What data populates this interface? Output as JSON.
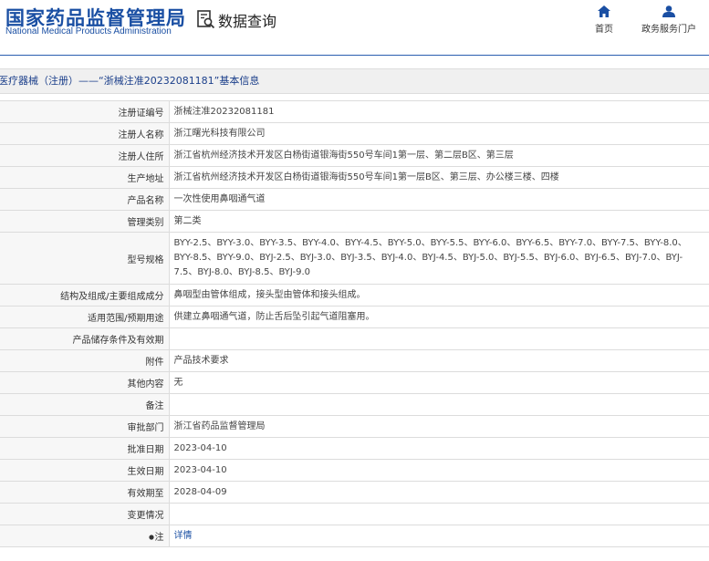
{
  "header": {
    "logo_cn": "国家药品监督管理局",
    "logo_en": "National Medical Products Administration",
    "query_title": "数据查询",
    "nav": [
      {
        "label": "首页",
        "icon": "home-icon"
      },
      {
        "label": "政务服务门户",
        "icon": "user-icon"
      }
    ],
    "accent_color": "#1a4fa3"
  },
  "breadcrumb": "医疗器械（注册）——“浙械注准20232081181”基本信息",
  "rows": [
    {
      "label": "注册证编号",
      "value": "浙械注准20232081181"
    },
    {
      "label": "注册人名称",
      "value": "浙江曙光科技有限公司"
    },
    {
      "label": "注册人住所",
      "value": "浙江省杭州经济技术开发区白杨街道银海街550号车间1第一层、第二层B区、第三层"
    },
    {
      "label": "生产地址",
      "value": "浙江省杭州经济技术开发区白杨街道银海街550号车间1第一层B区、第三层、办公楼三楼、四楼"
    },
    {
      "label": "产品名称",
      "value": "一次性使用鼻咽通气道"
    },
    {
      "label": "管理类别",
      "value": "第二类"
    },
    {
      "label": "型号规格",
      "value": "BYY-2.5、BYY-3.0、BYY-3.5、BYY-4.0、BYY-4.5、BYY-5.0、BYY-5.5、BYY-6.0、BYY-6.5、BYY-7.0、BYY-7.5、BYY-8.0、BYY-8.5、BYY-9.0、BYJ-2.5、BYJ-3.0、BYJ-3.5、BYJ-4.0、BYJ-4.5、BYJ-5.0、BYJ-5.5、BYJ-6.0、BYJ-6.5、BYJ-7.0、BYJ-7.5、BYJ-8.0、BYJ-8.5、BYJ-9.0"
    },
    {
      "label": "结构及组成/主要组成成分",
      "value": "鼻咽型由管体组成，接头型由管体和接头组成。"
    },
    {
      "label": "适用范围/预期用途",
      "value": "供建立鼻咽通气道，防止舌后坠引起气道阻塞用。"
    },
    {
      "label": "产品储存条件及有效期",
      "value": ""
    },
    {
      "label": "附件",
      "value": "产品技术要求"
    },
    {
      "label": "其他内容",
      "value": "无"
    },
    {
      "label": "备注",
      "value": ""
    },
    {
      "label": "审批部门",
      "value": "浙江省药品监督管理局"
    },
    {
      "label": "批准日期",
      "value": "2023-04-10"
    },
    {
      "label": "生效日期",
      "value": "2023-04-10"
    },
    {
      "label": "有效期至",
      "value": "2028-04-09"
    },
    {
      "label": "变更情况",
      "value": ""
    },
    {
      "label": "注",
      "value": "详情",
      "label_icon": "bullet-dot-icon"
    }
  ]
}
